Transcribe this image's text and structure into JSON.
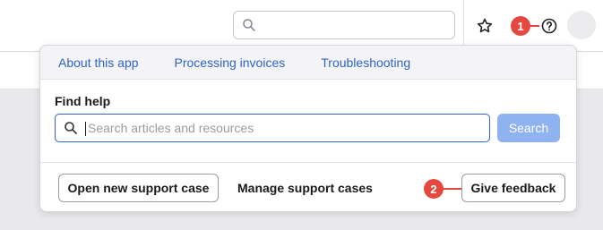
{
  "header": {
    "search": {
      "placeholder": "",
      "value": ""
    },
    "icons": {
      "star": "star-icon",
      "help": "help-circle-icon",
      "avatar": "avatar"
    }
  },
  "annotations": {
    "marker_1": "1",
    "marker_2": "2"
  },
  "help_panel": {
    "tabs": [
      {
        "label": "About this app"
      },
      {
        "label": "Processing invoices"
      },
      {
        "label": "Troubleshooting"
      }
    ],
    "find_help_label": "Find help",
    "search": {
      "placeholder": "Search articles and resources",
      "value": ""
    },
    "search_button": "Search",
    "open_case_button": "Open new support case",
    "manage_cases_link": "Manage support cases",
    "feedback_button": "Give feedback"
  },
  "colors": {
    "accent": "#2f63c8",
    "search_button_disabled": "#8fb2f0",
    "marker": "#e5483f",
    "background": "#e9e9eb"
  }
}
